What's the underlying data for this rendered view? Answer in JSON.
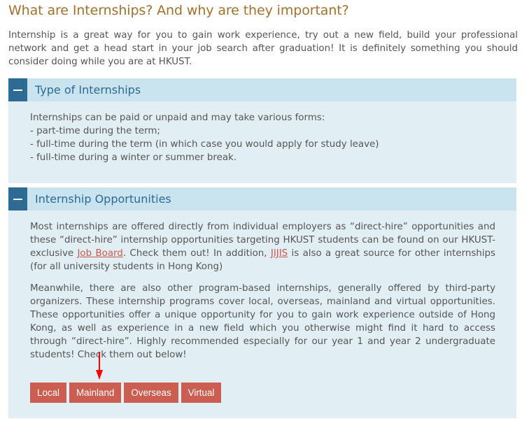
{
  "title": "What are Internships? And why are they important?",
  "intro": "Internship is a great way for you to gain work experience, try out a new field, build your professional network and get a head start in your job search after graduation! It is definitely something you should consider doing while you are at HKUST.",
  "sections": [
    {
      "heading": "Type of Internships",
      "lines": [
        "Internships can be paid or unpaid and may take various forms:",
        "- part-time during the term;",
        "- full-time during the term (in which case you would apply for study leave)",
        "- full-time during a winter or summer break."
      ]
    },
    {
      "heading": "Internship Opportunities",
      "p1_a": "Most internships are offered directly from individual employers as “direct-hire” opportunities and these “direct-hire” internship opportunities targeting HKUST students can be found on our HKUST-exclusive ",
      "p1_link1": "Job Board",
      "p1_b": ". Check them out! In addition, ",
      "p1_link2": "JIJIS",
      "p1_c": " is also a great source for other internships (for all university students in Hong Kong)",
      "p2": "Meanwhile, there are also other program-based internships, generally offered by third-party organizers. These internship programs cover local, overseas, mainland and virtual opportunities. These opportunities offer a unique opportunity for you to gain work experience outside of Hong Kong, as well as experience in a new field which you otherwise might find it hard to access through “direct-hire”. Highly recommended especially for our year 1 and year 2 undergraduate students! Check them out below!",
      "buttons": [
        "Local",
        "Mainland",
        "Overseas",
        "Virtual"
      ]
    }
  ],
  "colors": {
    "title": "#a0722f",
    "accent": "#2d6a94",
    "button": "#cb5e51",
    "arrow": "#ff0000"
  }
}
